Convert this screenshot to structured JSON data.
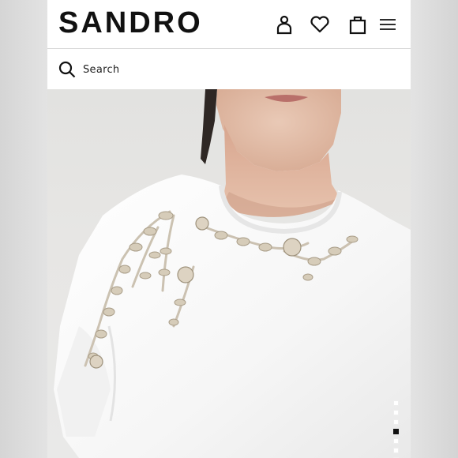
{
  "header": {
    "logo": "SANDRO",
    "icons": [
      "account-icon",
      "wishlist-heart-icon",
      "shopping-bag-icon",
      "menu-hamburger-icon"
    ]
  },
  "search": {
    "placeholder": "Search",
    "icon": "search-icon"
  },
  "product": {
    "image_description_icon": "product-photo",
    "carousel": {
      "total": 7,
      "active_index": 3
    }
  },
  "colors": {
    "text": "#111111",
    "background": "#ffffff",
    "active_dot": "#111111"
  }
}
